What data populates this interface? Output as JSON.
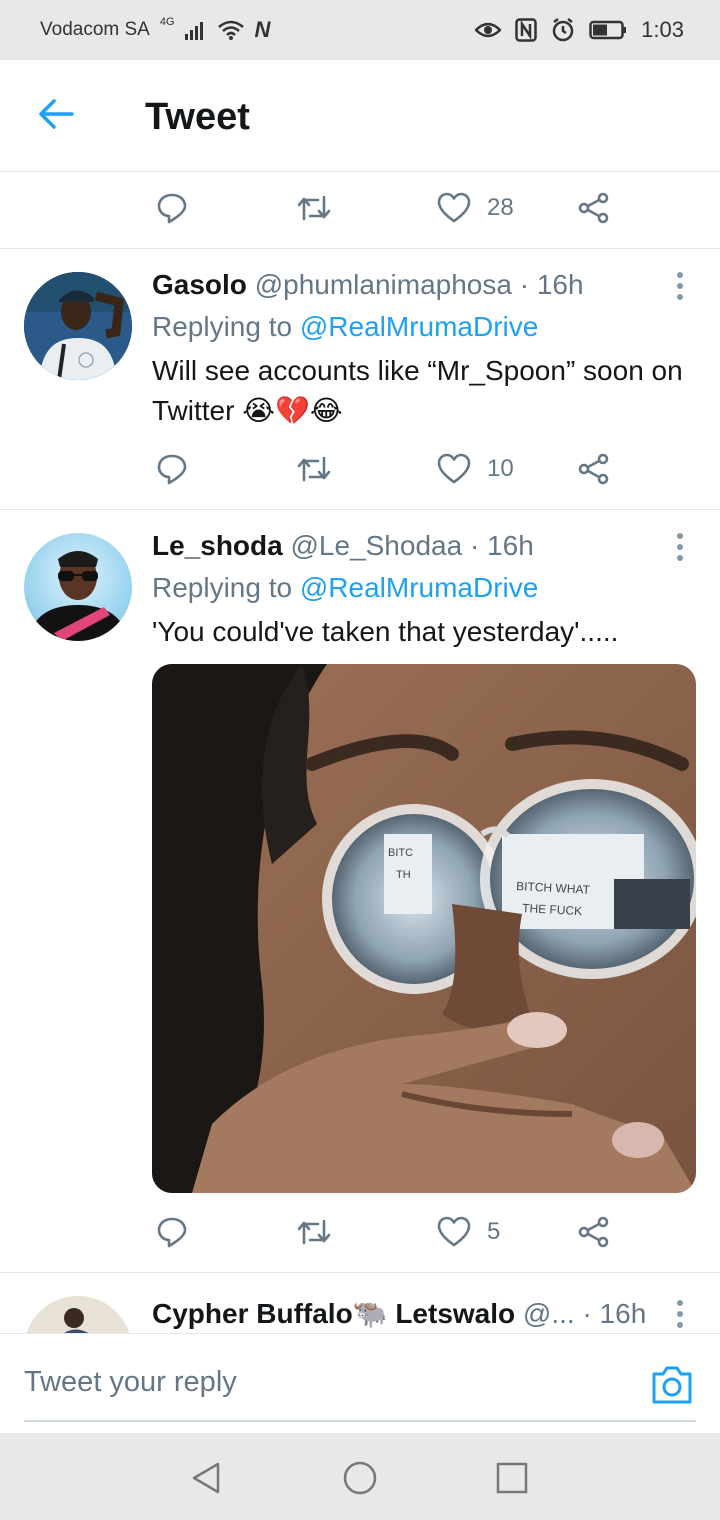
{
  "status_bar": {
    "carrier": "Vodacom SA",
    "network": "4G",
    "time": "1:03"
  },
  "header": {
    "title": "Tweet"
  },
  "top_actions": {
    "like_count": "28"
  },
  "tweets": [
    {
      "display_name": "Gasolo",
      "handle": "@phumlanimaphosa",
      "time": "· 16h",
      "replying_prefix": "Replying to",
      "replying_to": "@RealMrumaDrive",
      "text": "Will see accounts like “Mr_Spoon” soon on Twitter 😭💔😂",
      "like_count": "10"
    },
    {
      "display_name": "Le_shoda",
      "handle": "@Le_Shodaa",
      "time": "· 16h",
      "replying_prefix": "Replying to",
      "replying_to": "@RealMrumaDrive",
      "text": "'You could've taken that yesterday'.....",
      "like_count": "5",
      "media": {
        "lens_left_text": "BITC\nTH",
        "lens_right_line1": "BITCH WHAT",
        "lens_right_line2": "THE FUCK"
      }
    },
    {
      "display_name": "Cypher Buffalo🐃 Letswalo",
      "handle": "@...",
      "time": "· 16h"
    }
  ],
  "composer": {
    "placeholder": "Tweet your reply"
  },
  "colors": {
    "accent": "#1da1f2",
    "secondary_text": "#657786",
    "divider": "#e1e8ed"
  },
  "icons": [
    "back-arrow-icon",
    "reply-icon",
    "retweet-icon",
    "like-icon",
    "share-icon",
    "more-icon",
    "camera-icon",
    "nav-back-icon",
    "nav-home-icon",
    "nav-recents-icon"
  ]
}
